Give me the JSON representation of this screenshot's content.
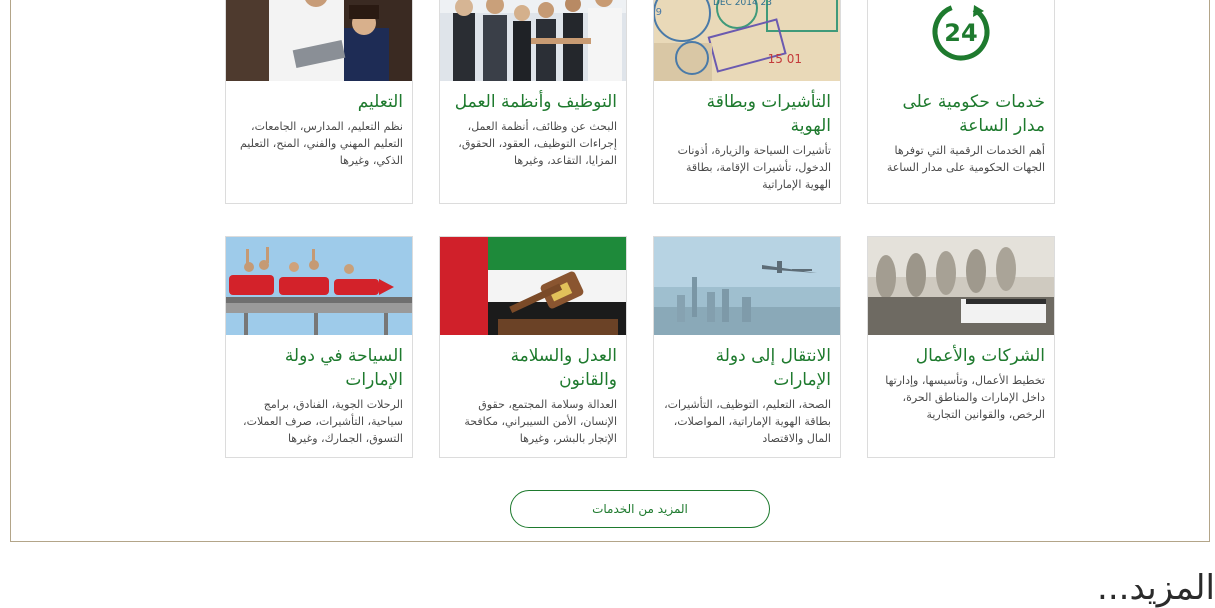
{
  "cards": [
    {
      "title": "خدمات حكومية على مدار الساعة",
      "desc": "أهم الخدمات الرقمية التي توفرها الجهات الحكومية على مدار الساعة",
      "image": "24-hour-icon"
    },
    {
      "title": "التأشيرات وبطاقة الهوية",
      "desc": "تأشيرات السياحة والزيارة، أذونات الدخول، تأشيرات الإقامة، بطاقة الهوية الإماراتية",
      "image": "passport-stamps-image"
    },
    {
      "title": "التوظيف وأنظمة العمل",
      "desc": "البحث عن وظائف، أنظمة العمل، إجراءات التوظيف، العقود، الحقوق، المزايا، التقاعد، وغيرها",
      "image": "business-handshake-image"
    },
    {
      "title": "التعليم",
      "desc": "نظم التعليم، المدارس، الجامعات، التعليم المهني والفني، المنح، التعليم الذكي، وغيرها",
      "image": "education-image"
    },
    {
      "title": "الشركات والأعمال",
      "desc": "تخطيط الأعمال، وتأسيسها، وإدارتها داخل الإمارات والمناطق الحرة، الرخص، والقوانين التجارية",
      "image": "boardroom-image"
    },
    {
      "title": "الانتقال إلى دولة الإمارات",
      "desc": "الصحة، التعليم، التوظيف، التأشيرات، بطاقة الهوية الإماراتية، المواصلات، المال والاقتصاد",
      "image": "airplane-city-image"
    },
    {
      "title": "العدل والسلامة والقانون",
      "desc": "العدالة وسلامة المجتمع، حقوق الإنسان، الأمن السيبراني، مكافحة الإتجار بالبشر، وغيرها",
      "image": "gavel-flag-image"
    },
    {
      "title": "السياحة في دولة الإمارات",
      "desc": "الرحلات الجوية، الفنادق، برامج سياحية، التأشيرات، صرف العملات، التسوق، الجمارك، وغيرها",
      "image": "rollercoaster-image"
    }
  ],
  "more_button": "المزيد من الخدمات",
  "bottom_heading": "المزيد...",
  "colors": {
    "accent": "#1e7a2e",
    "border": "#b3a589"
  }
}
